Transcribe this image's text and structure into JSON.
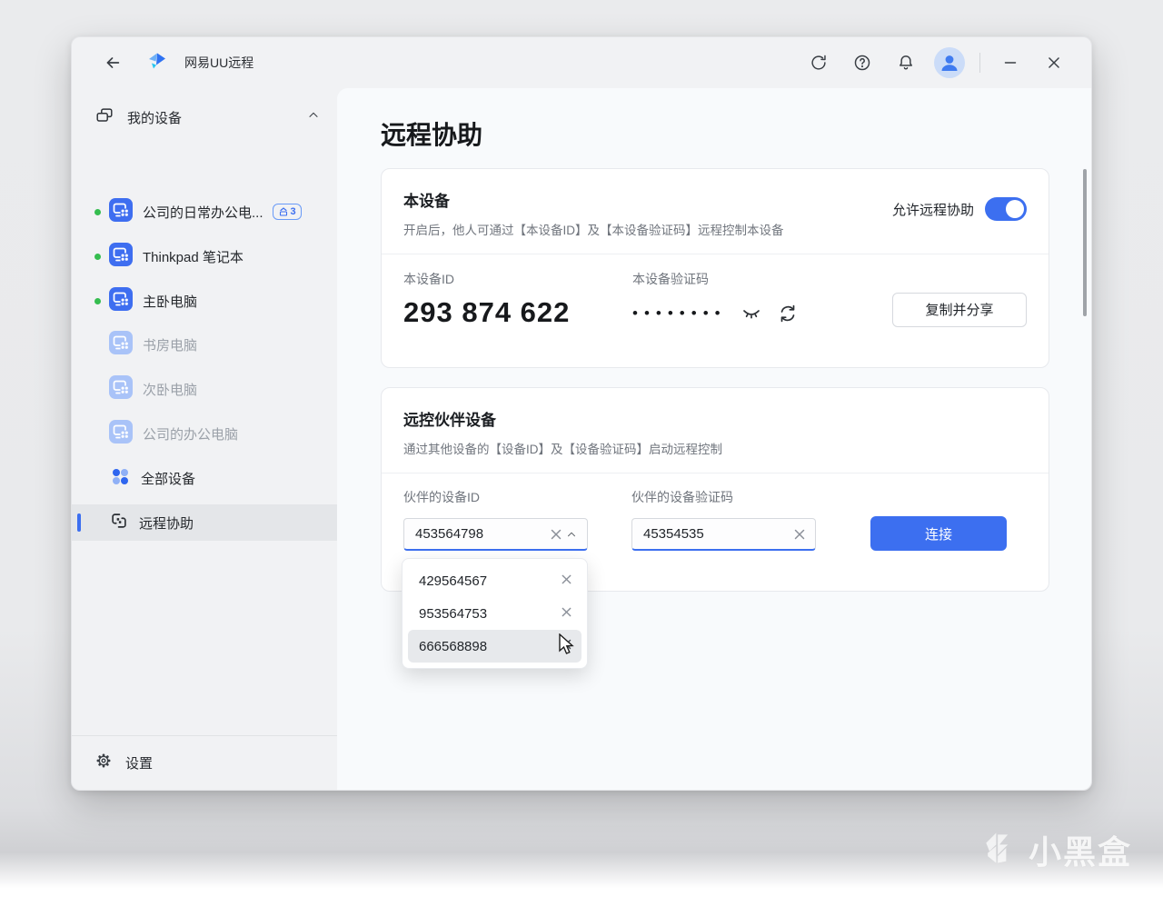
{
  "titlebar": {
    "title": "网易UU远程"
  },
  "sidebar": {
    "header_label": "我的设备",
    "devices": [
      {
        "label": "公司的日常办公电...",
        "online": true,
        "badge": "3"
      },
      {
        "label": "Thinkpad 笔记本",
        "online": true
      },
      {
        "label": "主卧电脑",
        "online": true
      },
      {
        "label": "书房电脑",
        "online": false
      },
      {
        "label": "次卧电脑",
        "online": false
      },
      {
        "label": "公司的办公电脑",
        "online": false
      }
    ],
    "all_devices_label": "全部设备",
    "remote_assist_label": "远程协助",
    "settings_label": "设置"
  },
  "main": {
    "page_title": "远程协助",
    "local_device": {
      "title": "本设备",
      "description": "开启后，他人可通过【本设备ID】及【本设备验证码】远程控制本设备",
      "toggle_label": "允许远程协助",
      "toggle_state": "on",
      "id_label": "本设备ID",
      "id_value": "293 874 622",
      "code_label": "本设备验证码",
      "code_masked": "••••••••",
      "copy_share_label": "复制并分享"
    },
    "partner": {
      "title": "远控伙伴设备",
      "description": "通过其他设备的【设备ID】及【设备验证码】启动远程控制",
      "id_label": "伙伴的设备ID",
      "id_value": "453564798",
      "code_label": "伙伴的设备验证码",
      "code_value": "45354535",
      "connect_label": "连接",
      "history": [
        "429564567",
        "953564753",
        "666568898"
      ]
    }
  },
  "watermark": {
    "text": "小黑盒"
  },
  "colors": {
    "accent_blue": "#3c6ff0",
    "online_green": "#35bd4f",
    "offline_icon_blue": "#a9c3f8",
    "panel_bg": "#f8fafc",
    "window_bg": "#f1f2f4"
  }
}
